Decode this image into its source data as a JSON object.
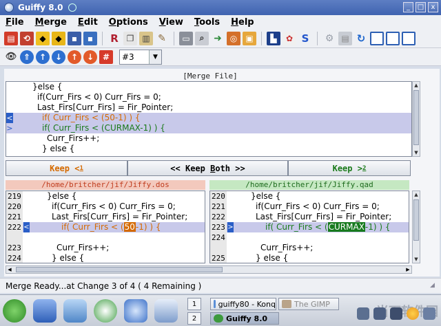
{
  "window": {
    "title": "Guiffy 8.0",
    "min": "_",
    "max": "□",
    "close": "x"
  },
  "menu": [
    "File",
    "Merge",
    "Edit",
    "Options",
    "View",
    "Tools",
    "Help"
  ],
  "menu_underline": [
    "F",
    "M",
    "E",
    "O",
    "V",
    "T",
    "H"
  ],
  "toolbar2": {
    "change_combo_value": "#3"
  },
  "merge": {
    "title": "[Merge File]",
    "lines": [
      {
        "text": "}else {",
        "indent": 4,
        "style": "normal",
        "mark": ""
      },
      {
        "text": "if(Curr_Firs < 0) Curr_Firs = 0;",
        "indent": 5,
        "style": "normal",
        "mark": ""
      },
      {
        "text": "Last_Firs[Curr_Firs] = Fir_Pointer;",
        "indent": 5,
        "style": "normal",
        "mark": ""
      },
      {
        "text": "if( Curr_Firs < (50-1) ) {",
        "indent": 6,
        "style": "orange",
        "mark": "<"
      },
      {
        "text": "if( Curr_Firs < (CURMAX-1) ) {",
        "indent": 6,
        "style": "green",
        "mark": ">"
      },
      {
        "text": "Curr_Firs++;",
        "indent": 7,
        "style": "normal",
        "mark": ""
      },
      {
        "text": "} else {",
        "indent": 6,
        "style": "normal",
        "mark": ""
      }
    ]
  },
  "keep": {
    "left": "Keep <",
    "left_u": "1",
    "both_pre": "<< Keep ",
    "both_u": "B",
    "both_post": "oth >>",
    "right": "Keep >",
    "right_u": "2"
  },
  "left_file": {
    "path": "/home/britcher/jif/Jiffy.dos",
    "lines": [
      {
        "num": "219",
        "text": "}else {",
        "indent": 3
      },
      {
        "num": "220",
        "text": "if(Curr_Firs < 0) Curr_Firs = 0;",
        "indent": 4
      },
      {
        "num": "221",
        "text": "Last_Firs[Curr_Firs] = Fir_Pointer;",
        "indent": 4
      }
    ],
    "change": {
      "num": "222",
      "pre": "if( Curr_Firs < (",
      "boxed": "50",
      "post": "-1) ) {"
    },
    "after": [
      {
        "num": "",
        "text": "",
        "indent": 0
      },
      {
        "num": "223",
        "text": "Curr_Firs++;",
        "indent": 5
      },
      {
        "num": "224",
        "text": "} else {",
        "indent": 4
      }
    ]
  },
  "right_file": {
    "path": "/home/britcher/jif/Jiffy.qad",
    "lines": [
      {
        "num": "220",
        "text": "}else {",
        "indent": 3
      },
      {
        "num": "221",
        "text": "if(Curr_Firs < 0) Curr_Firs = 0;",
        "indent": 4
      },
      {
        "num": "222",
        "text": "Last_Firs[Curr_Firs] = Fir_Pointer;",
        "indent": 4
      }
    ],
    "change": {
      "num": "223",
      "pre": "if( Curr_Firs < (",
      "boxed": "CURMAX",
      "post": "-1) ) {"
    },
    "after": [
      {
        "num": "224",
        "text": "",
        "indent": 0
      },
      {
        "num": "",
        "text": "Curr_Firs++;",
        "indent": 5
      },
      {
        "num": "225",
        "text": "} else {",
        "indent": 4
      }
    ]
  },
  "status": "Merge Ready...at Change 3 of 4 ( 4 Remaining )",
  "taskbar": {
    "desk1": "1",
    "desk2": "2",
    "task1": "guiffy80 - Konq",
    "task2": "The GIMP",
    "task3": "Guiffy 8.0",
    "watermark": "当下软件园"
  },
  "colors": {
    "orange": "#d56a00",
    "green": "#1a7a1a",
    "highlight": "#c8c9ea"
  }
}
